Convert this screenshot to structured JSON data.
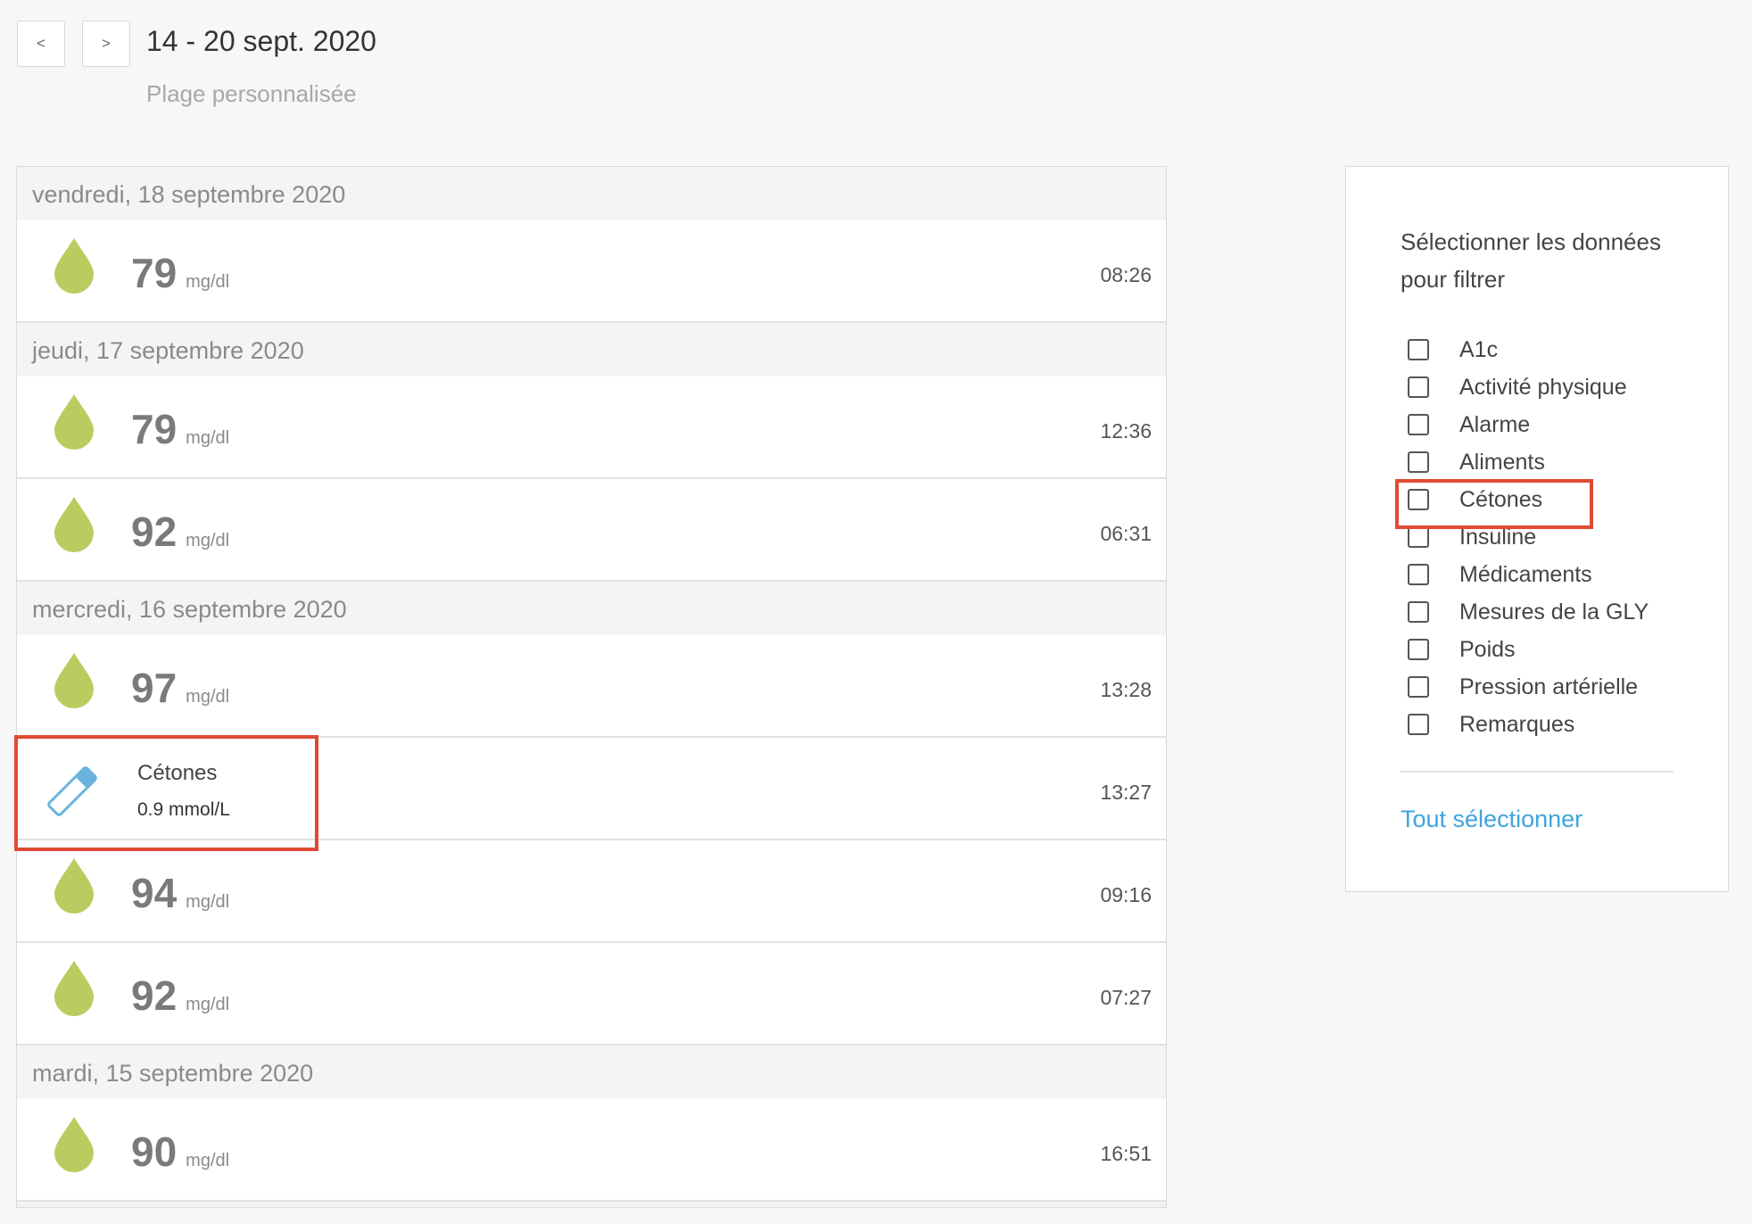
{
  "nav": {
    "prev_label": "<",
    "next_label": ">"
  },
  "header": {
    "date_range": "14 - 20 sept. 2020",
    "range_type": "Plage personnalisée"
  },
  "days": [
    {
      "label": "vendredi, 18 septembre 2020"
    },
    {
      "label": "jeudi, 17 septembre 2020"
    },
    {
      "label": "mercredi, 16 septembre 2020"
    },
    {
      "label": "mardi, 15 septembre 2020"
    }
  ],
  "entries": [
    {
      "value": "79",
      "unit": "mg/dl",
      "time": "08:26"
    },
    {
      "value": "79",
      "unit": "mg/dl",
      "time": "12:36"
    },
    {
      "value": "92",
      "unit": "mg/dl",
      "time": "06:31"
    },
    {
      "value": "97",
      "unit": "mg/dl",
      "time": "13:28"
    },
    {
      "title": "Cétones",
      "value": "0.9 mmol/L",
      "time": "13:27"
    },
    {
      "value": "94",
      "unit": "mg/dl",
      "time": "09:16"
    },
    {
      "value": "92",
      "unit": "mg/dl",
      "time": "07:27"
    },
    {
      "value": "90",
      "unit": "mg/dl",
      "time": "16:51"
    }
  ],
  "filter": {
    "title": "Sélectionner les données pour filtrer",
    "options": [
      {
        "label": "A1c",
        "checked": false
      },
      {
        "label": "Activité physique",
        "checked": false
      },
      {
        "label": "Alarme",
        "checked": false
      },
      {
        "label": "Aliments",
        "checked": false
      },
      {
        "label": "Cétones",
        "checked": false
      },
      {
        "label": "Insuline",
        "checked": false
      },
      {
        "label": "Médicaments",
        "checked": false
      },
      {
        "label": "Mesures de la GLY",
        "checked": false
      },
      {
        "label": "Poids",
        "checked": false
      },
      {
        "label": "Pression artérielle",
        "checked": false
      },
      {
        "label": "Remarques",
        "checked": false
      }
    ],
    "select_all": "Tout sélectionner"
  },
  "icons": {
    "glucose": "drop-icon",
    "ketone": "ketone-strip-icon",
    "checkbox": "checkbox-icon"
  },
  "colors": {
    "drop": "#bccb5f",
    "accent": "#3ea4dc",
    "highlight": "#e04a34",
    "strip": "#6bb3de"
  }
}
